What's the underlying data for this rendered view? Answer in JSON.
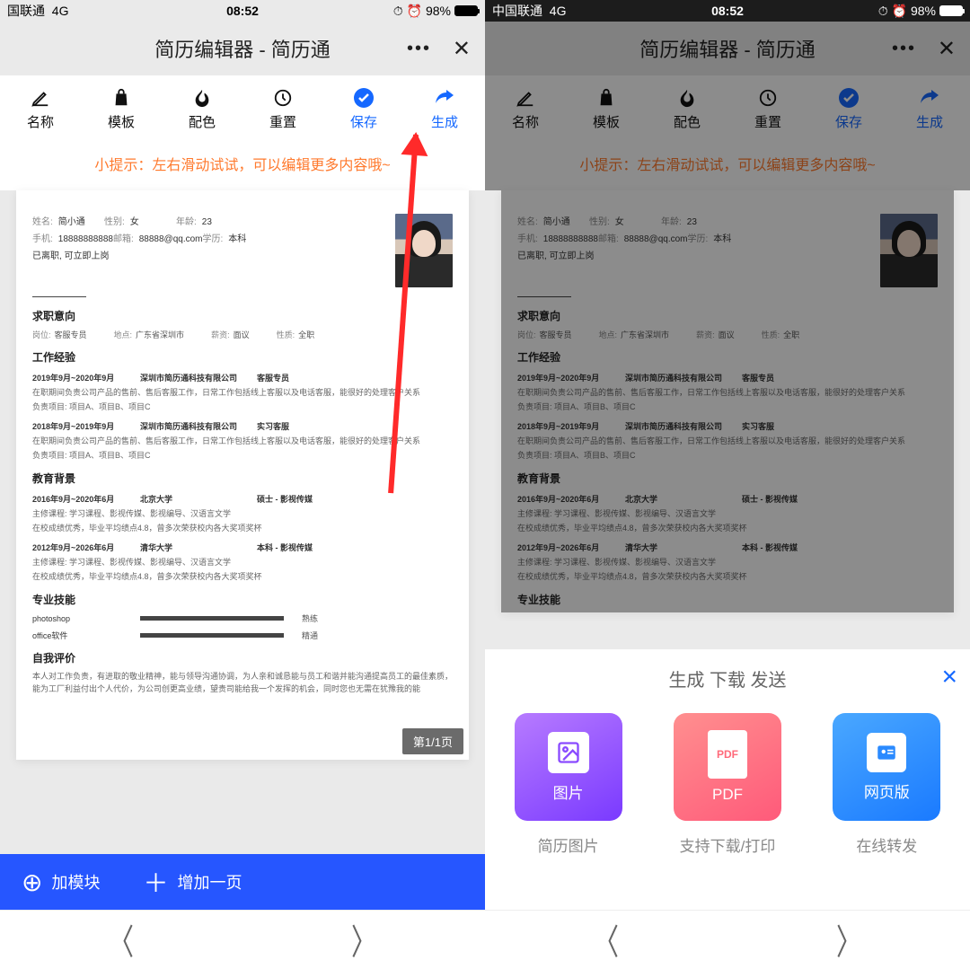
{
  "status": {
    "carrier": "国联通",
    "net": "4G",
    "time": "08:52",
    "batt": "98%",
    "carrier_r": "中国联通"
  },
  "title": "简历编辑器 - 简历通",
  "toolbar": [
    {
      "label": "名称",
      "key": "name-tool"
    },
    {
      "label": "模板",
      "key": "template-tool"
    },
    {
      "label": "配色",
      "key": "color-tool"
    },
    {
      "label": "重置",
      "key": "reset-tool"
    },
    {
      "label": "保存",
      "key": "save-tool",
      "blue": true
    },
    {
      "label": "生成",
      "key": "generate-tool",
      "blue": true
    }
  ],
  "hint": "小提示：左右滑动试试，可以编辑更多内容哦~",
  "resume": {
    "name_l": "姓名:",
    "name": "简小通",
    "sex_l": "性别:",
    "sex": "女",
    "age_l": "年龄:",
    "age": "23",
    "phone_l": "手机:",
    "phone": "18888888888",
    "mail_l": "邮箱:",
    "mail": "88888@qq.com",
    "edu_l": "学历:",
    "edu": "本科",
    "leave": "已离职, 可立即上岗",
    "s_intent": "求职意向",
    "pos_l": "岗位:",
    "pos": "客服专员",
    "loc_l": "地点:",
    "loc": "广东省深圳市",
    "sal_l": "薪资:",
    "sal": "面议",
    "nat_l": "性质:",
    "nat": "全职",
    "s_exp": "工作经验",
    "exp1_t": "2019年9月~2020年9月",
    "exp1_c": "深圳市简历通科技有限公司",
    "exp1_r": "客服专员",
    "exp_d1": "在职期间负责公司产品的售前、售后客服工作，日常工作包括线上客服以及电话客服，能很好的处理客户关系",
    "exp_d2": "负责项目: 项目A、项目B、项目C",
    "exp2_t": "2018年9月~2019年9月",
    "exp2_c": "深圳市简历通科技有限公司",
    "exp2_r": "实习客服",
    "s_edu": "教育背景",
    "edu1_t": "2016年9月~2020年6月",
    "edu1_c": "北京大学",
    "edu1_r": "硕士 - 影视传媒",
    "edu_d1": "主修课程: 学习课程、影视传媒、影视编导、汉语言文学",
    "edu_d2": "在校成绩优秀，毕业平均绩点4.8，曾多次荣获校内各大奖项奖杯",
    "edu2_t": "2012年9月~2026年6月",
    "edu2_c": "清华大学",
    "edu2_r": "本科 - 影视传媒",
    "s_skill": "专业技能",
    "sk1": "photoshop",
    "sk1l": "熟练",
    "sk2": "office软件",
    "sk2l": "精通",
    "s_self": "自我评价",
    "self": "本人对工作负责，有进取的敬业精神，能与领导沟通协调，为人亲和诚恳能与员工和谐并能沟通提高员工的最佳素质，能为工厂利益付出个人代价，为公司创更高业绩，望贵司能给我一个发挥的机会，同时您也无需在犹豫我的能",
    "pager": "第1/1页"
  },
  "bottom": {
    "add_mod": "加模块",
    "add_page": "增加一页"
  },
  "sheet": {
    "title": "生成 下载 发送",
    "cards": [
      {
        "icon_label": "图片",
        "sub": "简历图片"
      },
      {
        "icon_label": "PDF",
        "sub": "支持下载/打印"
      },
      {
        "icon_label": "网页版",
        "sub": "在线转发"
      }
    ]
  }
}
